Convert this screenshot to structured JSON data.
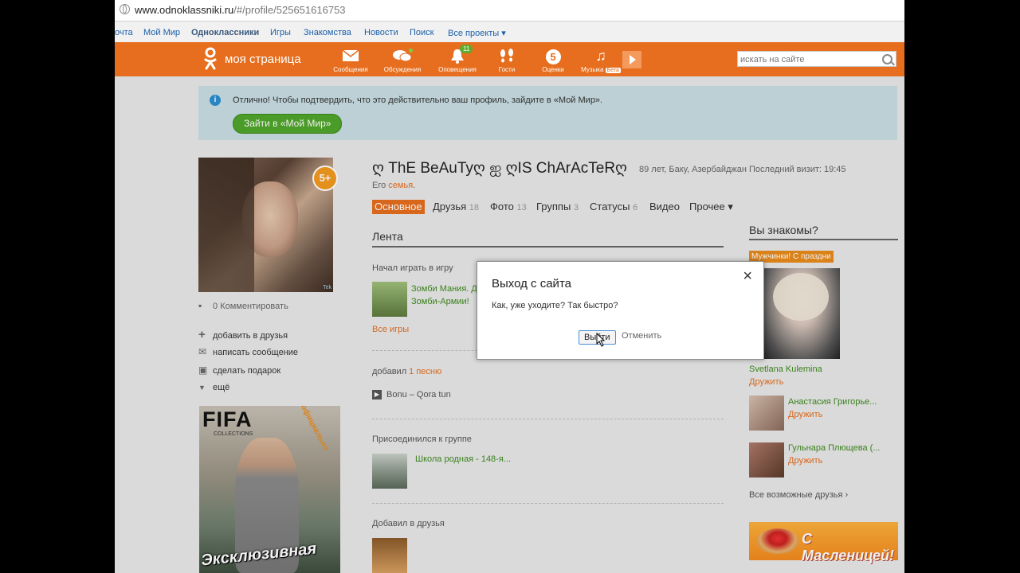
{
  "browser": {
    "url_host": "www.odnoklassniki.ru",
    "url_path": "/#/profile/525651616753"
  },
  "portal": {
    "items": [
      "очта",
      "Мой Мир",
      "Одноклассники",
      "Игры",
      "Знакомства",
      "Новости",
      "Поиск",
      "Все проекты ▾"
    ]
  },
  "toolbar": {
    "title": "моя страница",
    "items": [
      {
        "label": "Сообщения",
        "icon": "envelope-icon"
      },
      {
        "label": "Обсуждения",
        "icon": "chat-icon"
      },
      {
        "label": "Оповещения",
        "icon": "bell-icon",
        "badge": "11"
      },
      {
        "label": "Гости",
        "icon": "footprints-icon"
      },
      {
        "label": "Оценки",
        "icon": "rating-icon",
        "badge": "5"
      },
      {
        "label": "Музыка",
        "icon": "music-icon",
        "beta": "Бета"
      }
    ],
    "search_placeholder": "искать на сайте"
  },
  "banner": {
    "message": "Отлично! Чтобы подтвердить, что это действительно ваш профиль, зайдите в «Мой Мир».",
    "button": "Зайти в «Мой Мир»"
  },
  "left": {
    "avatar_seal": "5+",
    "comments": "0 Комментировать",
    "add_friend": "добавить в друзья",
    "write_message": "написать сообщение",
    "gift": "сделать подарок",
    "more": "ещё",
    "promo_title": "FIFA",
    "promo_sub": "COLLECTIONS",
    "promo_tag": "официально",
    "promo_bottom": "Эксклюзивная"
  },
  "profile": {
    "name": "ღ ThE BeAuTyღ ஐ ღIS ChArAcTeRღ",
    "meta": "89 лет, Баку, Азербайджан  Последний визит: 19:45",
    "family_prefix": "Его",
    "family_link": "семья",
    "tabs": [
      {
        "label": "Основное",
        "count": ""
      },
      {
        "label": "Друзья",
        "count": "18"
      },
      {
        "label": "Фото",
        "count": "13"
      },
      {
        "label": "Группы",
        "count": "3"
      },
      {
        "label": "Статусы",
        "count": "6"
      },
      {
        "label": "Видео",
        "count": ""
      },
      {
        "label": "Прочее ▾",
        "count": ""
      }
    ]
  },
  "feed": {
    "title": "Лента",
    "game_header": "Начал играть в игру",
    "game_line1": "Зомби Мания. Д",
    "game_line2": "Зомби-Армии!",
    "all_games": "Все игры",
    "song_prefix": "добавил",
    "song_link": "1 песню",
    "song": "Bonu – Qora tun",
    "group_header": "Присоединился к группе",
    "group_name": "Школа родная - 148-я...",
    "friends_header": "Добавил в друзья"
  },
  "right": {
    "title": "Вы знакомы?",
    "badge": "Мужчинки! С праздни",
    "people": [
      {
        "name": "Svetlana Kulemina",
        "action": "Дружить"
      },
      {
        "name": "Анастасия Григорье...",
        "action": "Дружить"
      },
      {
        "name": "Гульнара Плющева (...",
        "action": "Дружить"
      }
    ],
    "all": "Все возможные друзья ›",
    "promo": "С Масленицей!"
  },
  "dialog": {
    "title": "Выход с сайта",
    "message": "Как, уже уходите? Так быстро?",
    "ok": "Выйти",
    "cancel": "Отменить"
  }
}
